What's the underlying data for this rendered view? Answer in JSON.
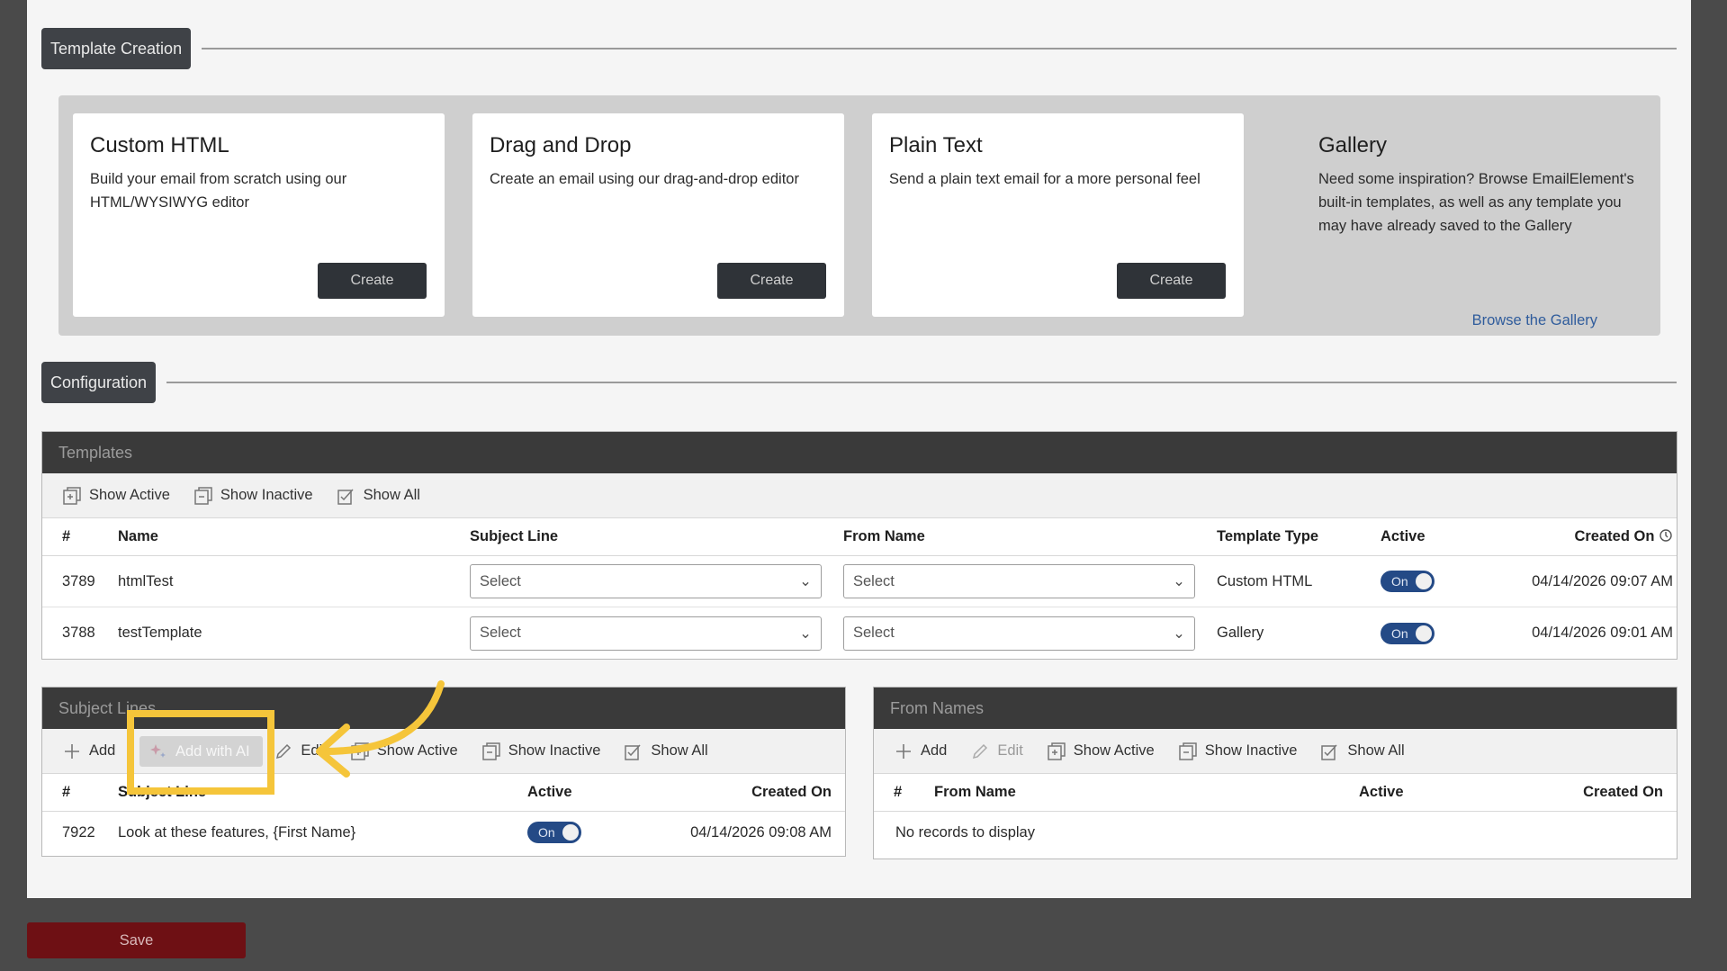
{
  "sections": {
    "template_creation": "Template Creation",
    "configuration": "Configuration"
  },
  "cards": [
    {
      "title": "Custom HTML",
      "desc": "Build your email from scratch using our HTML/WYSIWYG editor",
      "button": "Create"
    },
    {
      "title": "Drag and Drop",
      "desc": "Create an email using our drag-and-drop editor",
      "button": "Create"
    },
    {
      "title": "Plain Text",
      "desc": "Send a plain text email for a more personal feel",
      "button": "Create"
    }
  ],
  "gallery": {
    "title": "Gallery",
    "desc": "Need some inspiration? Browse EmailElement's built-in templates, as well as any template you may have already saved to the Gallery",
    "link": "Browse the Gallery"
  },
  "templates": {
    "title": "Templates",
    "toolbar": {
      "show_active": "Show Active",
      "show_inactive": "Show Inactive",
      "show_all": "Show All"
    },
    "headers": {
      "num": "#",
      "name": "Name",
      "subject": "Subject Line",
      "from": "From Name",
      "type": "Template Type",
      "active": "Active",
      "created": "Created On"
    },
    "rows": [
      {
        "num": "3789",
        "name": "htmlTest",
        "subject": "Select",
        "from": "Select",
        "type": "Custom HTML",
        "active": "On",
        "created": "04/14/2026 09:07 AM"
      },
      {
        "num": "3788",
        "name": "testTemplate",
        "subject": "Select",
        "from": "Select",
        "type": "Gallery",
        "active": "On",
        "created": "04/14/2026 09:01 AM"
      }
    ]
  },
  "subject_lines": {
    "title": "Subject Lines",
    "toolbar": {
      "add": "Add",
      "add_ai": "Add with AI",
      "edit": "Edit",
      "show_active": "Show Active",
      "show_inactive": "Show Inactive",
      "show_all": "Show All"
    },
    "headers": {
      "num": "#",
      "subject": "Subject Line",
      "active": "Active",
      "created": "Created On"
    },
    "rows": [
      {
        "num": "7922",
        "subject": "Look at these features, {First Name}",
        "active": "On",
        "created": "04/14/2026 09:08 AM"
      }
    ]
  },
  "from_names": {
    "title": "From Names",
    "toolbar": {
      "add": "Add",
      "edit": "Edit",
      "show_active": "Show Active",
      "show_inactive": "Show Inactive",
      "show_all": "Show All"
    },
    "headers": {
      "num": "#",
      "from": "From Name",
      "active": "Active",
      "created": "Created On"
    },
    "empty": "No records to display"
  },
  "save": "Save",
  "colors": {
    "highlight": "#f5c53a",
    "toggle": "#244a86",
    "save": "#6e1014"
  }
}
